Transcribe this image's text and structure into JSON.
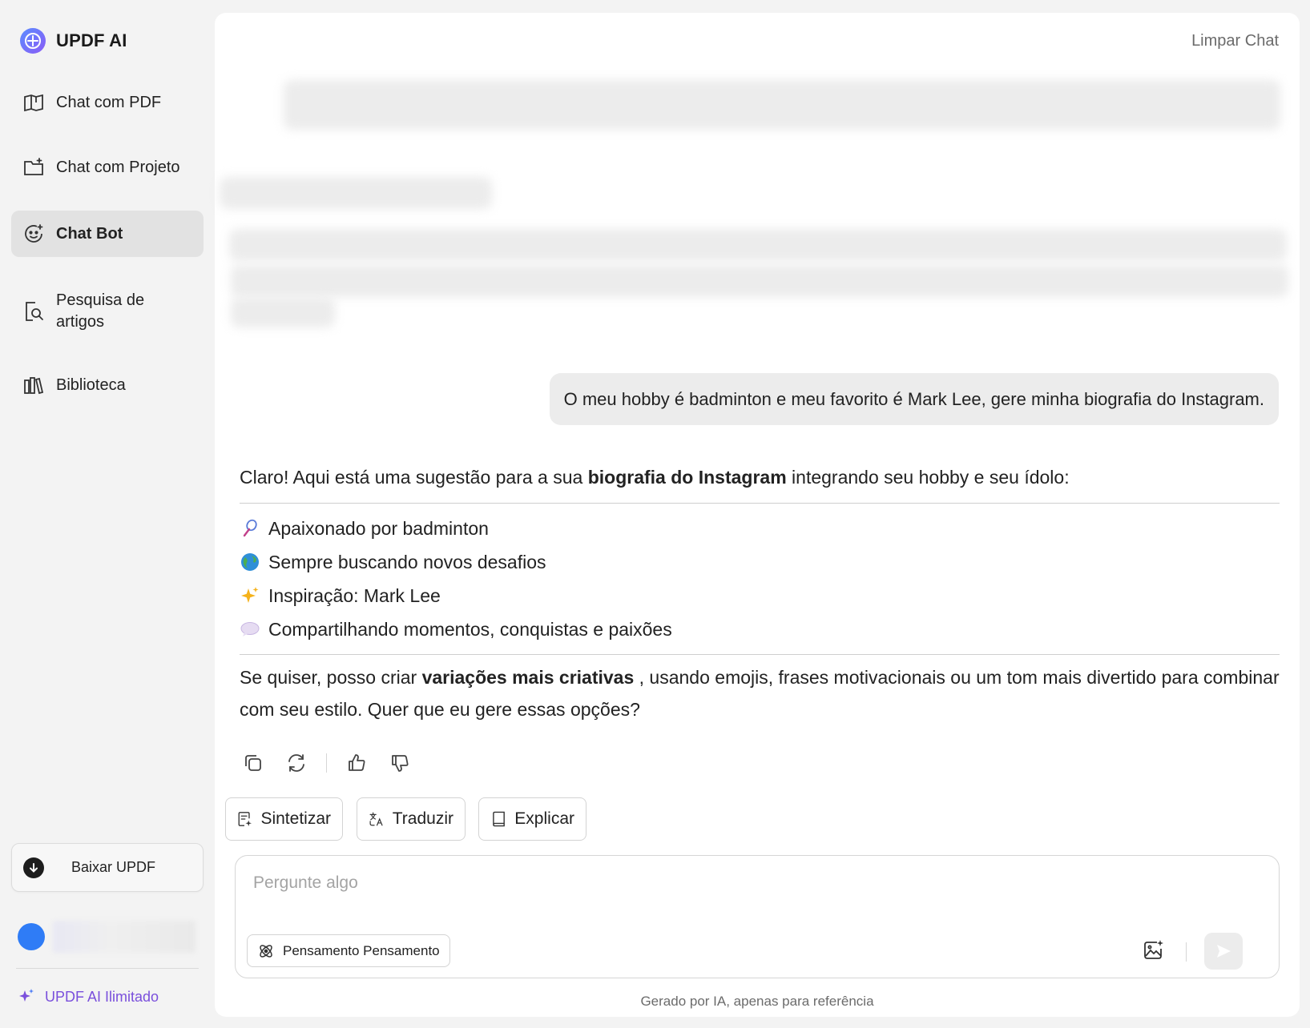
{
  "app": {
    "name": "UPDF AI"
  },
  "sidebar": {
    "items": [
      {
        "label": "Chat com PDF",
        "icon": "book-chat-icon"
      },
      {
        "label": "Chat com Projeto",
        "icon": "folder-chat-icon"
      },
      {
        "label": "Chat Bot",
        "icon": "bot-icon",
        "active": true
      },
      {
        "label": "Pesquisa de artigos",
        "icon": "article-search-icon"
      },
      {
        "label": "Biblioteca",
        "icon": "library-icon"
      }
    ],
    "download_label": "Baixar UPDF",
    "unlimited_label": "UPDF AI Ilimitado"
  },
  "header": {
    "clear_label": "Limpar Chat"
  },
  "conversation": {
    "user_message": "O meu hobby é badminton e meu favorito é Mark Lee, gere minha biografia do Instagram.",
    "answer_intro_pre": "Claro! Aqui está uma sugestão para a sua ",
    "answer_intro_bold": "biografia do Instagram",
    "answer_intro_post": " integrando seu hobby e seu ídolo:",
    "bio_lines": [
      {
        "emoji": "badminton-icon",
        "text": "Apaixonado por badminton"
      },
      {
        "emoji": "globe-icon",
        "text": "Sempre buscando novos desafios"
      },
      {
        "emoji": "sparkles-icon",
        "text": "Inspiração: Mark Lee"
      },
      {
        "emoji": "speech-bubble-icon",
        "text": "Compartilhando momentos, conquistas e paixões"
      }
    ],
    "answer_outro_pre": "Se quiser, posso criar ",
    "answer_outro_bold": "variações mais criativas",
    "answer_outro_post": " , usando emojis, frases motivacionais ou um tom mais divertido para combinar com seu estilo. Quer que eu gere essas opções?"
  },
  "quick_actions": {
    "summarize": "Sintetizar",
    "translate": "Traduzir",
    "explain": "Explicar"
  },
  "composer": {
    "placeholder": "Pergunte algo",
    "value": "",
    "thinking_label": "Pensamento Pensamento"
  },
  "footer": {
    "disclaimer": "Gerado por IA, apenas para referência"
  },
  "colors": {
    "accent": "#7a4fdc",
    "active_item": "#e2e2e2",
    "bubble": "#ececec"
  }
}
